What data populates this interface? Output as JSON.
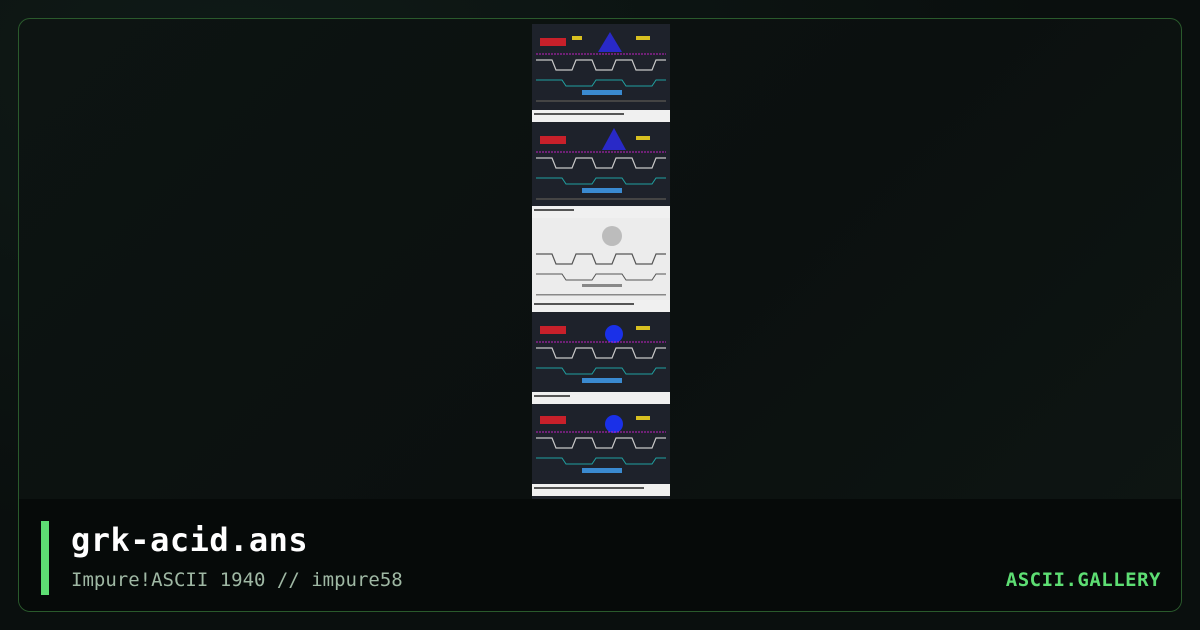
{
  "file": {
    "name": "grk-acid.ans",
    "subtitle": "Impure!ASCII 1940 // impure58"
  },
  "brand": {
    "label": "ASCII.GALLERY"
  },
  "colors": {
    "accent": "#5dde73",
    "frame_border": "#2a5a2c",
    "background": "#0a0f0e",
    "footer_background": "#060a09"
  },
  "preview": {
    "description": "ansi-art-thumbnail"
  }
}
